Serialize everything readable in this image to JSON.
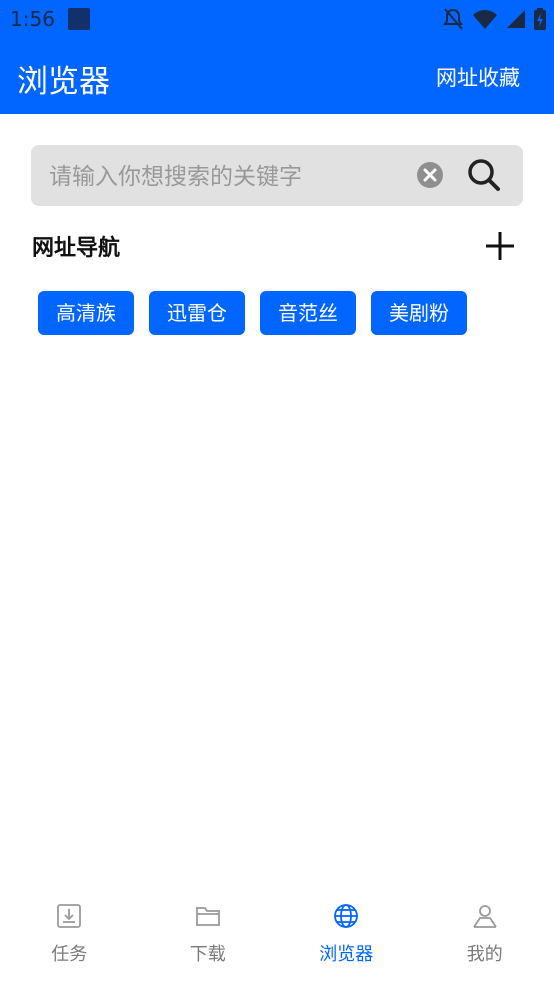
{
  "status_bar": {
    "time": "1:56"
  },
  "app_bar": {
    "title": "浏览器",
    "bookmarks_label": "网址收藏"
  },
  "search": {
    "placeholder": "请输入你想搜索的关键字",
    "value": ""
  },
  "navigation": {
    "title": "网址导航",
    "chips": [
      "高清族",
      "迅雷仓",
      "音范丝",
      "美剧粉"
    ]
  },
  "bottom_nav": {
    "items": [
      {
        "label": "任务",
        "icon": "download-tray-icon",
        "active": false
      },
      {
        "label": "下载",
        "icon": "folder-icon",
        "active": false
      },
      {
        "label": "浏览器",
        "icon": "globe-icon",
        "active": true
      },
      {
        "label": "我的",
        "icon": "person-icon",
        "active": false
      }
    ]
  },
  "colors": {
    "primary": "#0066ff",
    "inactive": "#7a7a7a",
    "search_bg": "#e1e1e1"
  }
}
